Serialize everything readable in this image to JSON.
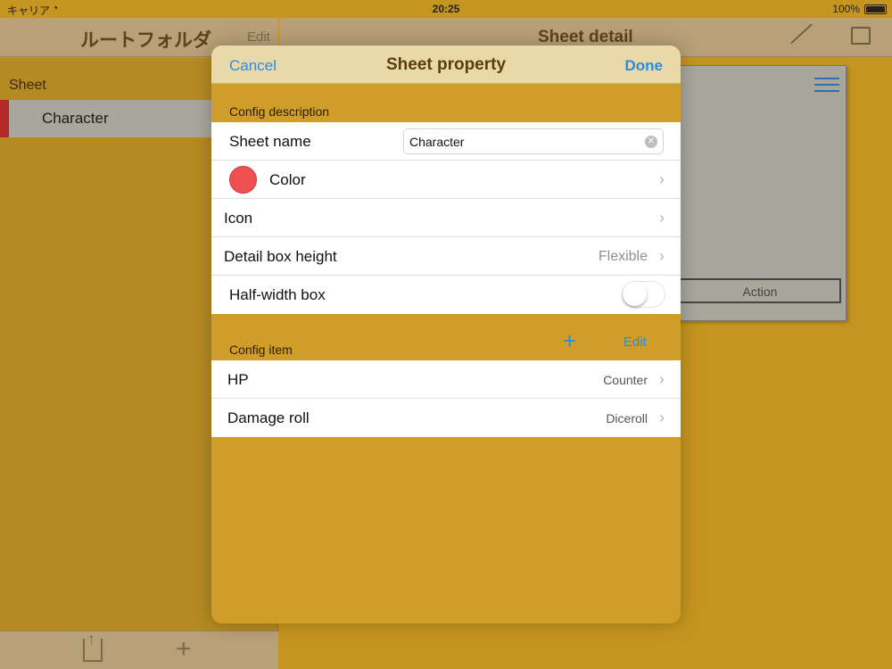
{
  "status": {
    "carrier": "キャリア",
    "time": "20:25",
    "battery": "100%"
  },
  "background": {
    "left_nav": {
      "title": "ルートフォルダ",
      "edit": "Edit"
    },
    "right_nav": {
      "title": "Sheet detail"
    },
    "left_pane": {
      "section": "Sheet",
      "items": [
        {
          "label": "Character",
          "color": "#b22a28"
        }
      ]
    },
    "card": {
      "action": "Action"
    }
  },
  "modal": {
    "cancel": "Cancel",
    "title": "Sheet property",
    "done": "Done",
    "config_description": {
      "header": "Config description",
      "sheet_name_label": "Sheet name",
      "sheet_name_value": "Character",
      "color_label": "Color",
      "color_value": "#f05050",
      "icon_label": "Icon",
      "detail_box_height_label": "Detail box height",
      "detail_box_height_value": "Flexible",
      "half_width_label": "Half-width box",
      "half_width_on": false
    },
    "config_item": {
      "header": "Config item",
      "plus": "+",
      "edit": "Edit",
      "items": [
        {
          "label": "HP",
          "type": "Counter"
        },
        {
          "label": "Damage roll",
          "type": "Diceroll"
        }
      ]
    }
  }
}
